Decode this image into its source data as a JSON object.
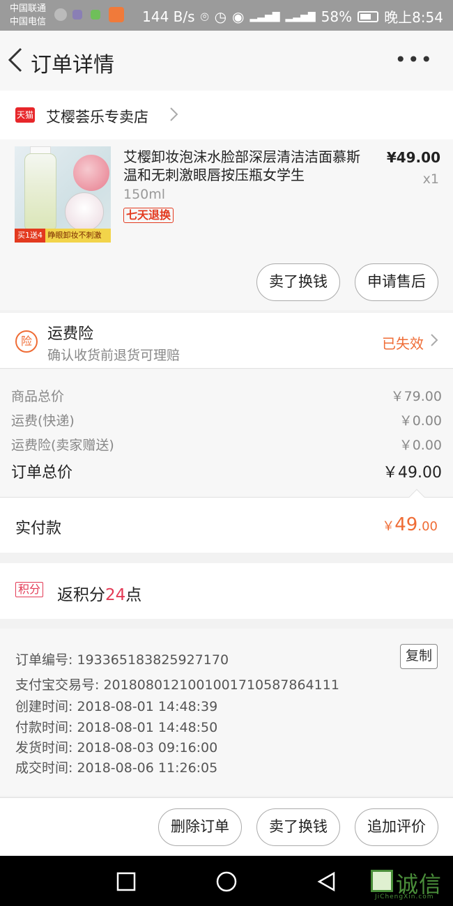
{
  "status_bar": {
    "carrier_1": "中国联通",
    "carrier_2": "中国电信",
    "speed": "144 B/s",
    "battery": "58%",
    "time": "晚上8:54"
  },
  "header": {
    "title": "订单详情"
  },
  "shop": {
    "badge": "天猫",
    "name": "艾樱荟乐专卖店"
  },
  "product": {
    "name": "艾樱卸妆泡沫水脸部深层清洁洁面慕斯温和无刺激眼唇按压瓶女学生",
    "spec": "150ml",
    "tag": "七天退换",
    "price": "¥49.00",
    "qty": "x1",
    "image_text_promo": "买1送4",
    "image_text_slogan": "睁眼卸妆不刺激",
    "btn_sell": "卖了换钱",
    "btn_aftersale": "申请售后"
  },
  "insurance": {
    "icon_text": "险",
    "title": "运费险",
    "subtitle": "确认收货前退货可理赔",
    "status": "已失效"
  },
  "cost": {
    "rows": [
      {
        "label": "商品总价",
        "value": "￥79.00"
      },
      {
        "label": "运费(快递)",
        "value": "￥0.00"
      },
      {
        "label": "运费险(卖家赠送)",
        "value": "￥0.00"
      },
      {
        "label": "订单总价",
        "value": "￥49.00"
      }
    ],
    "paid_label": "实付款",
    "paid_currency": "￥",
    "paid_int": "49",
    "paid_dec": ".00"
  },
  "points": {
    "badge": "积分",
    "text_pre": "返积分",
    "num": "24",
    "text_post": "点"
  },
  "info": {
    "lines": [
      "订单编号: 193365183825927170",
      "支付宝交易号: 2018080121001001710587864111",
      "创建时间: 2018-08-01 14:48:39",
      "付款时间: 2018-08-01 14:48:50",
      "发货时间: 2018-08-03 09:16:00",
      "成交时间: 2018-08-06 11:26:05"
    ],
    "copy_label": "复制"
  },
  "actions": {
    "delete": "删除订单",
    "sell": "卖了换钱",
    "review": "追加评价"
  },
  "watermark": {
    "text": "诚信",
    "sub": "JiChengXin.com"
  },
  "colors": {
    "accent": "#ef6c35",
    "tmall": "#e7262a",
    "points": "#e33a55"
  }
}
